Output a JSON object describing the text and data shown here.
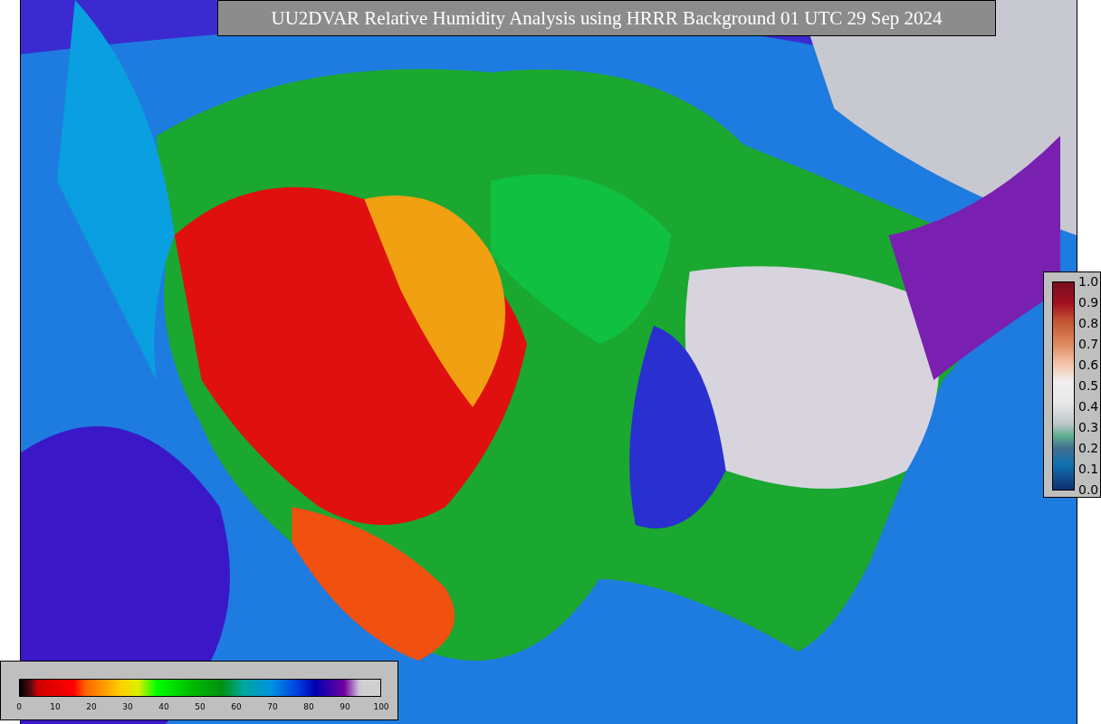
{
  "title": "UU2DVAR Relative Humidity Analysis using HRRR Background 01 UTC 29 Sep 2024",
  "colorbars": [
    {
      "kind": "vertical",
      "ticks": [
        "1.0",
        "0.9",
        "0.8",
        "0.7",
        "0.6",
        "0.5",
        "0.4",
        "0.3",
        "0.2",
        "0.1",
        "0.0"
      ]
    },
    {
      "kind": "horizontal",
      "ticks": [
        "0",
        "10",
        "20",
        "30",
        "40",
        "50",
        "60",
        "70",
        "80",
        "90",
        "100"
      ]
    }
  ]
}
